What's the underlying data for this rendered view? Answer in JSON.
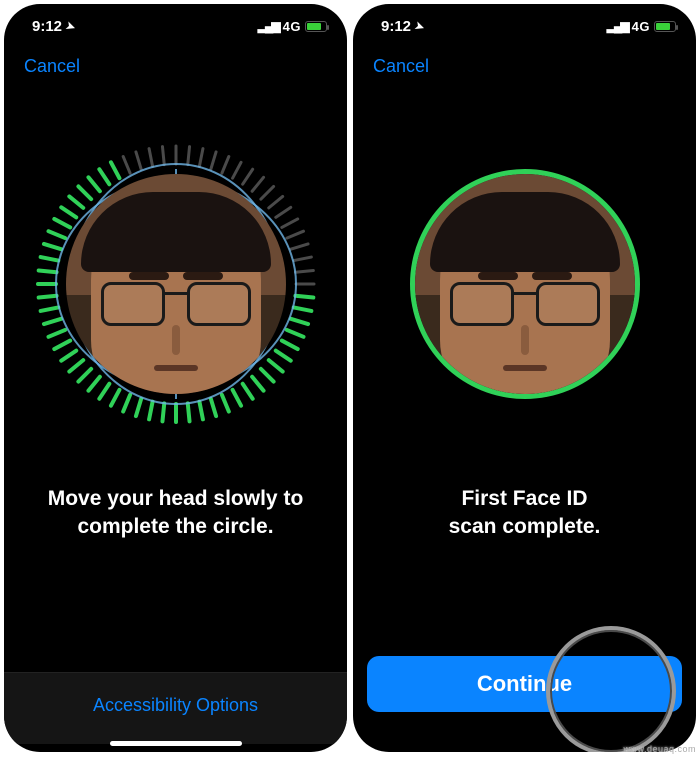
{
  "status": {
    "time": "9:12",
    "network": "4G"
  },
  "left": {
    "cancel": "Cancel",
    "message": "Move your head slowly to\ncomplete the circle.",
    "accessibility": "Accessibility Options"
  },
  "right": {
    "cancel": "Cancel",
    "message": "First Face ID\nscan complete.",
    "continue": "Continue"
  },
  "colors": {
    "link": "#0a84ff",
    "success": "#30d158",
    "buttonBg": "#0a84ff"
  },
  "watermark": "www.deuaq.com"
}
